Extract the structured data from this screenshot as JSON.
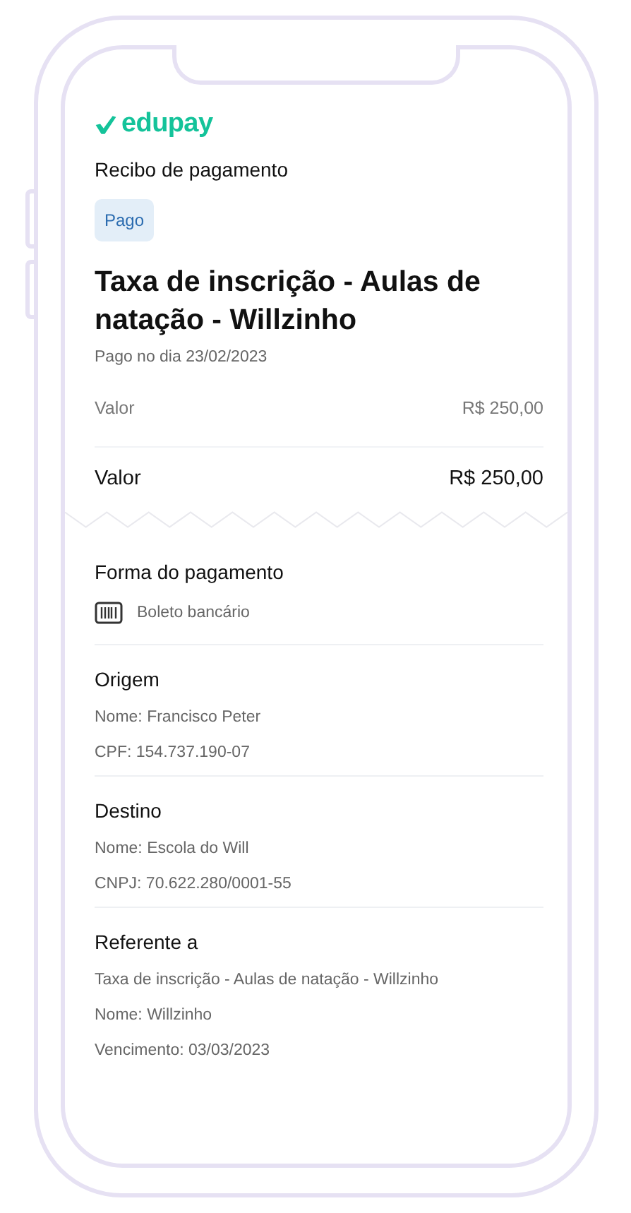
{
  "logo": {
    "text": "edupay"
  },
  "subtitle": "Recibo de pagamento",
  "status_badge": "Pago",
  "title": "Taxa de inscrição - Aulas de natação - Willzinho",
  "paid_date": "Pago no dia 23/02/2023",
  "summary": [
    {
      "kind": "line",
      "label": "Valor",
      "amount": "R$ 250,00"
    },
    {
      "kind": "total",
      "label": "Valor",
      "amount": "R$ 250,00"
    }
  ],
  "payment_method": {
    "heading": "Forma do pagamento",
    "method": "Boleto bancário"
  },
  "sections": [
    {
      "heading": "Origem",
      "lines": [
        "Nome: Francisco Peter",
        "CPF: 154.737.190-07"
      ]
    },
    {
      "heading": "Destino",
      "lines": [
        "Nome: Escola do Will",
        "CNPJ: 70.622.280/0001-55"
      ]
    },
    {
      "heading": "Referente a",
      "lines": [
        "Taxa de inscrição - Aulas de natação - Willzinho",
        "Nome: Willzinho",
        "Vencimento: 03/03/2023"
      ]
    }
  ]
}
